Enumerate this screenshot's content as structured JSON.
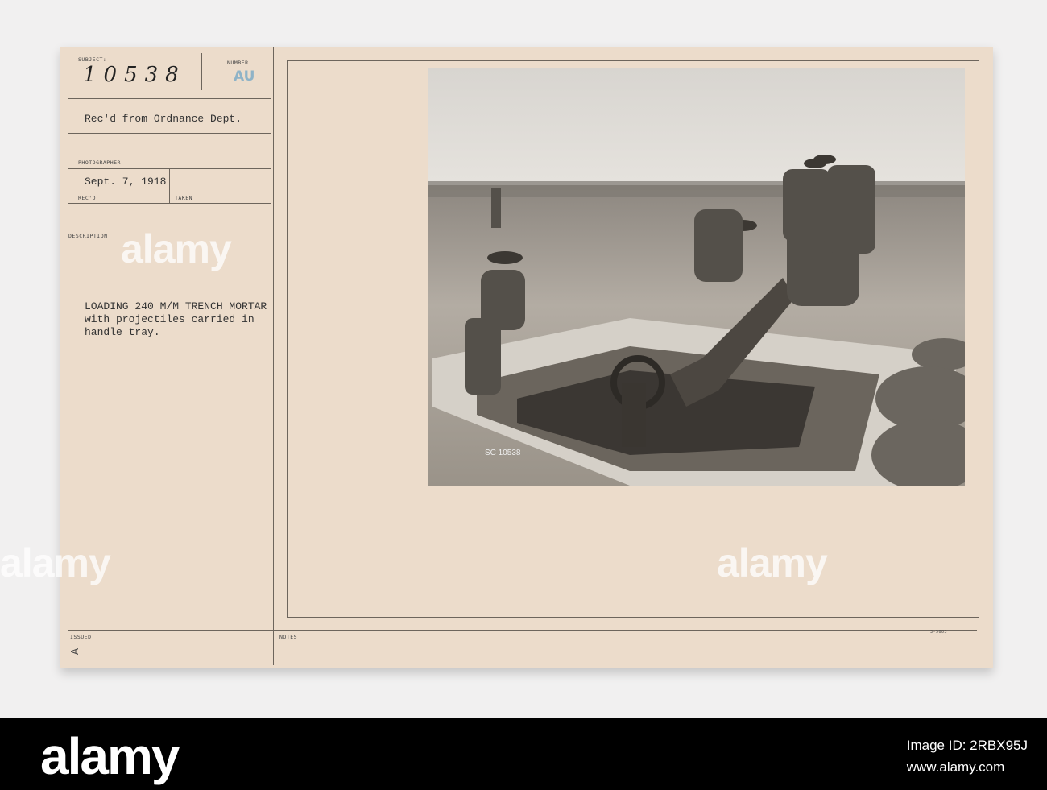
{
  "card": {
    "subject_label": "SUBJECT:",
    "subject_number": "10538",
    "number_label": "NUMBER",
    "number_stamp": "AU",
    "received_from": "Rec'd from Ordnance Dept.",
    "photographer_label": "PHOTOGRAPHER",
    "date": "Sept. 7, 1918",
    "recd_label": "REC'D",
    "taken_label": "TAKEN",
    "description_label": "DESCRIPTION",
    "description_lines": [
      "LOADING 240 M/M TRENCH MORTAR",
      "with projectiles carried in",
      "handle tray."
    ],
    "issued_label": "ISSUED",
    "issued_mark": "A",
    "notes_label": "NOTES",
    "form_number": "3-5003",
    "photo_caption": "SC 10538"
  },
  "watermark": {
    "text": "alamy"
  },
  "footer": {
    "brand": "alamy",
    "image_id": "Image ID: 2RBX95J",
    "url": "www.alamy.com"
  }
}
